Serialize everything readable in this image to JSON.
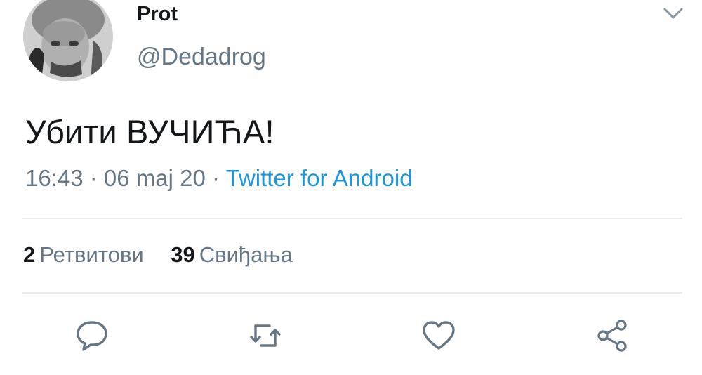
{
  "author": {
    "display_name": "Prot",
    "handle": "@Dedadrog",
    "avatar_icon": "profile-photo"
  },
  "menu_icon": "chevron-down-icon",
  "tweet": {
    "text": "Убити ВУЧИЋА!",
    "time": "16:43",
    "dot1": " · ",
    "date": "06 maj 20",
    "dot2": " · ",
    "source": "Twitter for Android"
  },
  "stats": {
    "retweets_count": "2",
    "retweets_label": "Ретвитови",
    "likes_count": "39",
    "likes_label": "Свиђања"
  },
  "actions": [
    {
      "name": "reply",
      "icon": "comment-icon"
    },
    {
      "name": "retweet",
      "icon": "retweet-icon"
    },
    {
      "name": "like",
      "icon": "heart-icon"
    },
    {
      "name": "share",
      "icon": "share-icon"
    }
  ],
  "colors": {
    "text": "#14171a",
    "secondary": "#657786",
    "link": "#1b95e0",
    "divider": "#e6ecf0"
  }
}
